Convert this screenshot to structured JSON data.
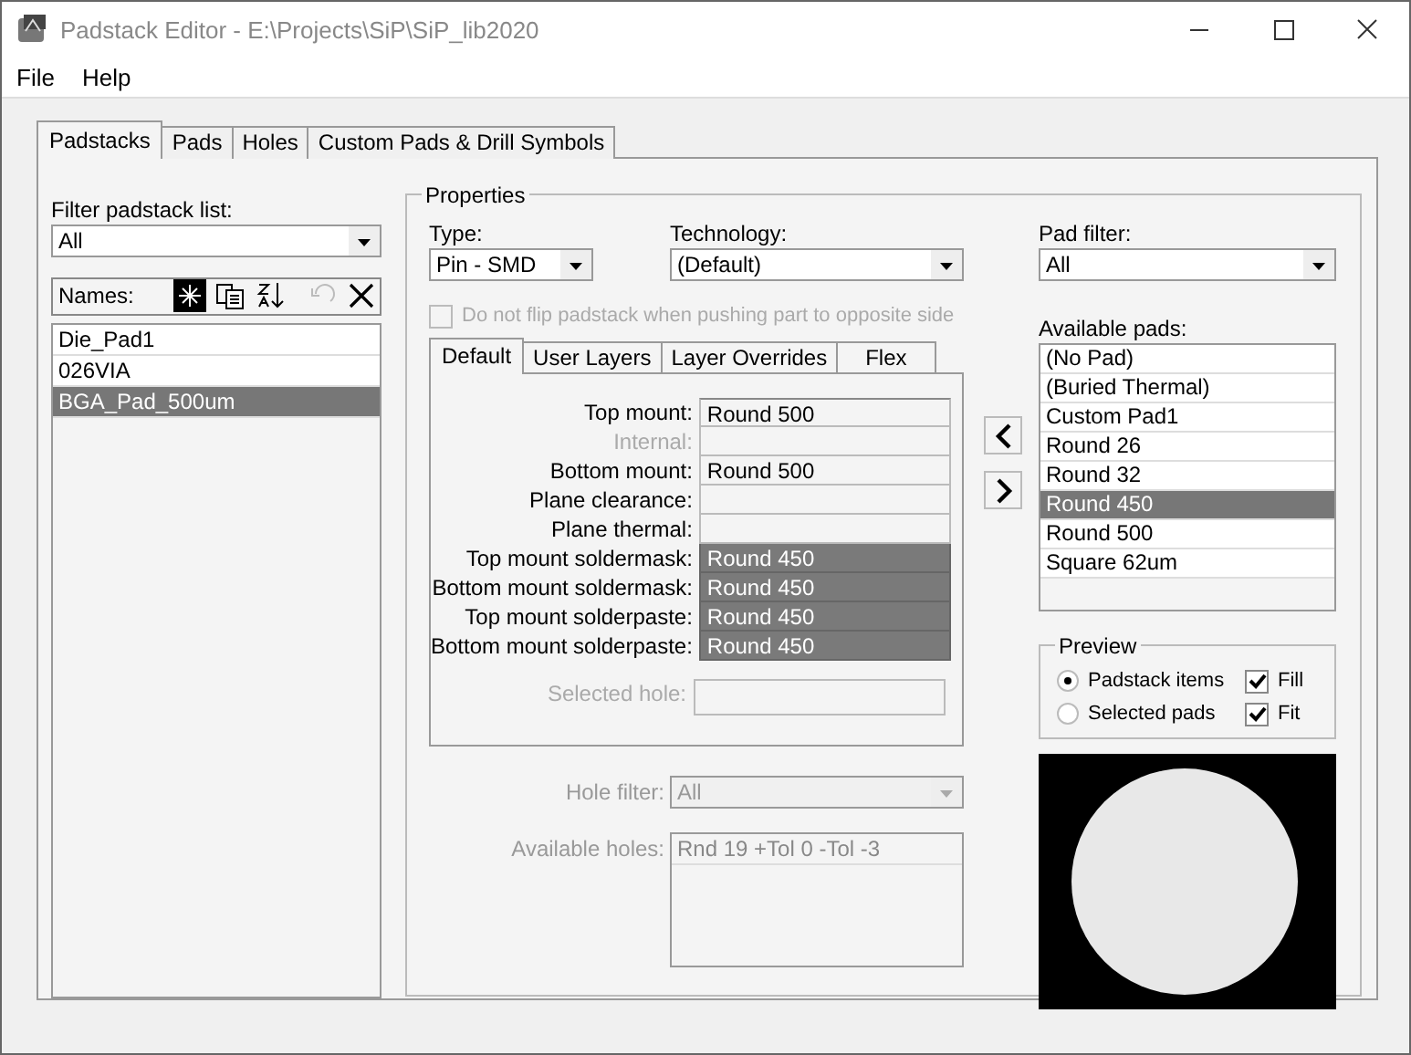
{
  "window": {
    "title": "Padstack Editor - E:\\Projects\\SiP\\SiP_lib2020"
  },
  "menu": [
    "File",
    "Help"
  ],
  "tabs": [
    {
      "label": "Padstacks",
      "selected": true
    },
    {
      "label": "Pads",
      "selected": false
    },
    {
      "label": "Holes",
      "selected": false
    },
    {
      "label": "Custom Pads & Drill Symbols",
      "selected": false
    }
  ],
  "filter": {
    "label": "Filter padstack list:",
    "value": "All"
  },
  "names": {
    "label": "Names:",
    "items": [
      {
        "label": "Die_Pad1",
        "selected": false
      },
      {
        "label": "026VIA",
        "selected": false
      },
      {
        "label": "BGA_Pad_500um",
        "selected": true
      }
    ]
  },
  "properties": {
    "title": "Properties",
    "type": {
      "label": "Type:",
      "value": "Pin - SMD"
    },
    "technology": {
      "label": "Technology:",
      "value": "(Default)"
    },
    "no_flip": {
      "label": "Do not flip padstack when pushing part to opposite side",
      "checked": false,
      "disabled": true
    },
    "tabs": [
      {
        "label": "Default",
        "selected": true
      },
      {
        "label": "User Layers",
        "selected": false
      },
      {
        "label": "Layer Overrides",
        "selected": false
      },
      {
        "label": "Flex",
        "selected": false
      }
    ],
    "layers": [
      {
        "label": "Top mount:",
        "value": "Round 500",
        "disabled": false,
        "selected": false
      },
      {
        "label": "Internal:",
        "disabled": true,
        "selected": false
      },
      {
        "label": "Bottom mount:",
        "value": "Round 500",
        "disabled": false,
        "selected": false
      },
      {
        "label": "Plane clearance:",
        "disabled": false,
        "selected": false
      },
      {
        "label": "Plane thermal:",
        "disabled": false,
        "selected": false
      },
      {
        "label": "Top mount soldermask:",
        "value": "Round 450",
        "disabled": false,
        "selected": true
      },
      {
        "label": "Bottom mount soldermask:",
        "value": "Round 450",
        "disabled": false,
        "selected": true
      },
      {
        "label": "Top mount solderpaste:",
        "value": "Round 450",
        "disabled": false,
        "selected": true
      },
      {
        "label": "Bottom mount solderpaste:",
        "value": "Round 450",
        "disabled": false,
        "selected": true
      }
    ],
    "selected_hole": {
      "label": "Selected hole:"
    },
    "hole_filter": {
      "label": "Hole filter:",
      "value": "All"
    },
    "available_holes": {
      "label": "Available holes:",
      "items": [
        "Rnd 19 +Tol 0 -Tol -3"
      ]
    },
    "pad_filter": {
      "label": "Pad filter:",
      "value": "All"
    },
    "available_pads": {
      "label": "Available pads:",
      "items": [
        {
          "label": "(No Pad)",
          "selected": false
        },
        {
          "label": "(Buried Thermal)",
          "selected": false
        },
        {
          "label": "Custom Pad1",
          "selected": false
        },
        {
          "label": "Round 26",
          "selected": false
        },
        {
          "label": "Round 32",
          "selected": false
        },
        {
          "label": "Round 450",
          "selected": true
        },
        {
          "label": "Round 500",
          "selected": false
        },
        {
          "label": "Square 62um",
          "selected": false
        }
      ]
    },
    "preview": {
      "title": "Preview",
      "modes": [
        {
          "label": "Padstack items",
          "selected": true
        },
        {
          "label": "Selected pads",
          "selected": false
        }
      ],
      "options": [
        {
          "label": "Fill",
          "checked": true
        },
        {
          "label": "Fit",
          "checked": true
        }
      ]
    }
  }
}
